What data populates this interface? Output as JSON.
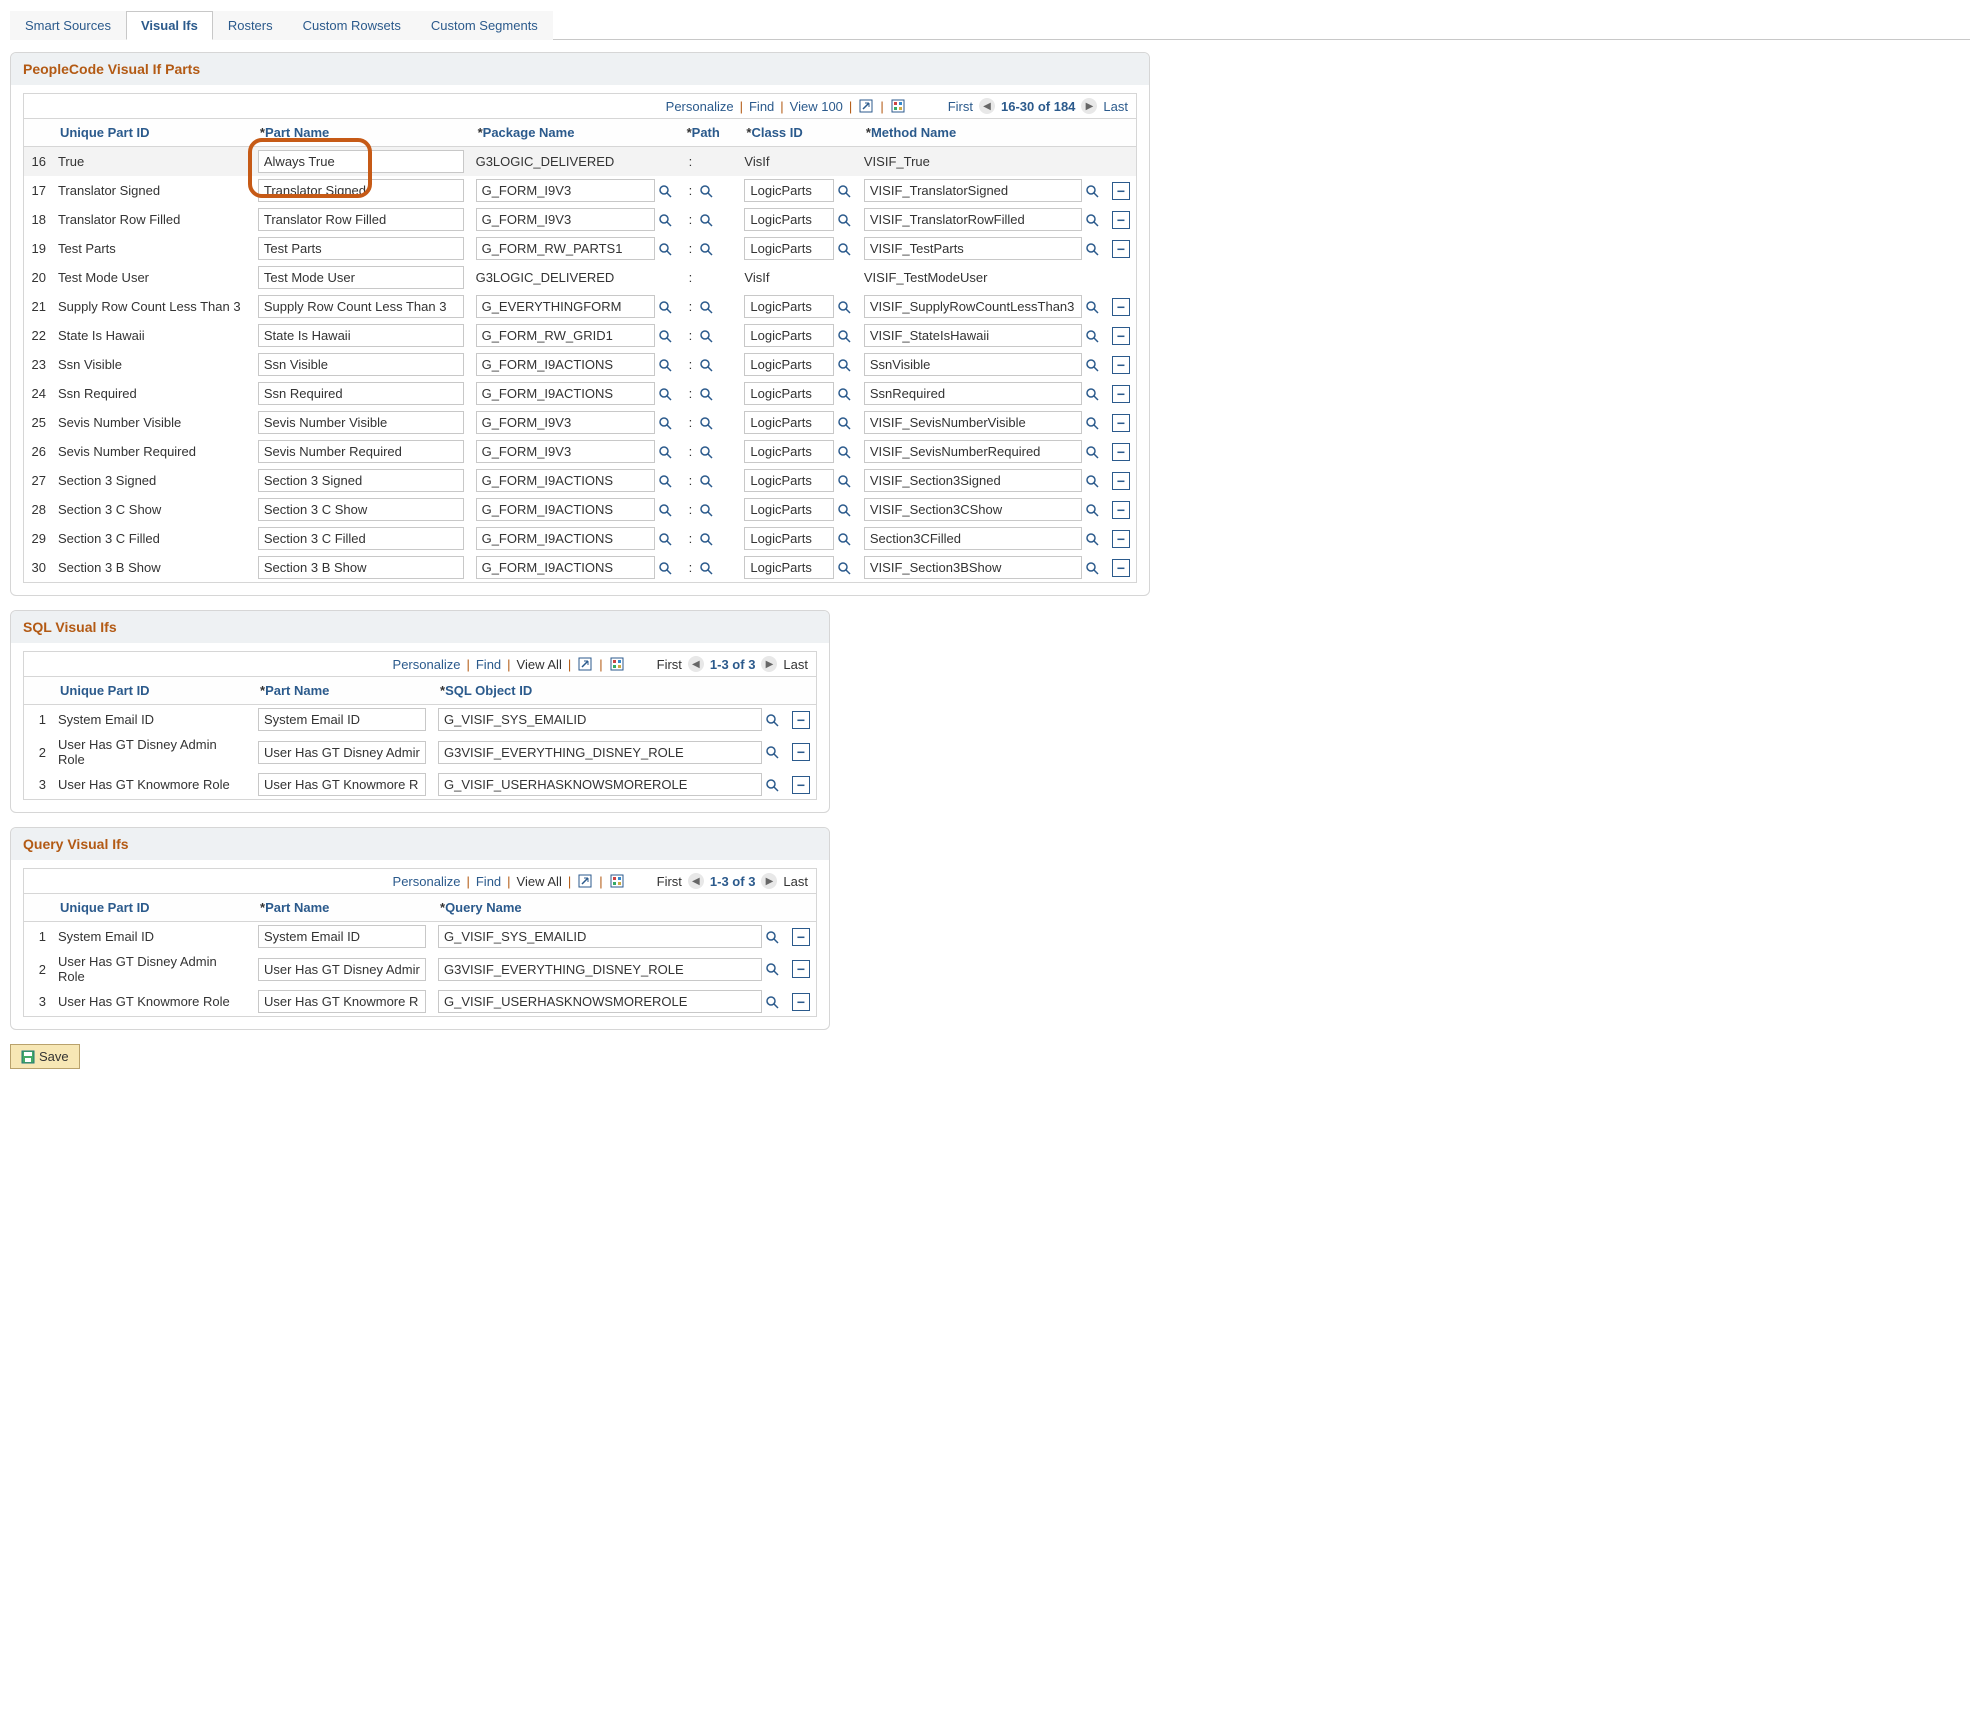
{
  "tabs": [
    "Smart Sources",
    "Visual Ifs",
    "Rosters",
    "Custom Rowsets",
    "Custom Segments"
  ],
  "active_tab": "Visual Ifs",
  "save_label": "Save",
  "toolbar": {
    "personalize": "Personalize",
    "find": "Find",
    "view100": "View 100",
    "viewall": "View All",
    "first": "First",
    "last": "Last"
  },
  "panels": {
    "pc": {
      "title": "PeopleCode Visual If Parts",
      "range": "16-30 of 184",
      "headers": {
        "id": "Unique Part ID",
        "name": "Part Name",
        "pkg": "Package Name",
        "path": "Path",
        "cls": "Class ID",
        "mth": "Method Name"
      },
      "rows": [
        {
          "n": 16,
          "id": "True",
          "name": "Always True",
          "pkg": "G3LOGIC_DELIVERED",
          "pkg_lookup": false,
          "path": "",
          "cls": "VisIf",
          "cls_lookup": false,
          "mth": "VISIF_True",
          "mth_lookup": false,
          "del": false,
          "alt": true
        },
        {
          "n": 17,
          "id": "Translator Signed",
          "name": "Translator Signed",
          "pkg": "G_FORM_I9V3",
          "pkg_lookup": true,
          "path": "",
          "cls": "LogicParts",
          "cls_lookup": true,
          "mth": "VISIF_TranslatorSigned",
          "mth_lookup": true,
          "del": true,
          "alt": false
        },
        {
          "n": 18,
          "id": "Translator Row Filled",
          "name": "Translator Row Filled",
          "pkg": "G_FORM_I9V3",
          "pkg_lookup": true,
          "path": "",
          "cls": "LogicParts",
          "cls_lookup": true,
          "mth": "VISIF_TranslatorRowFilled",
          "mth_lookup": true,
          "del": true,
          "alt": false
        },
        {
          "n": 19,
          "id": "Test Parts",
          "name": "Test Parts",
          "pkg": "G_FORM_RW_PARTS1",
          "pkg_lookup": true,
          "path": "",
          "cls": "LogicParts",
          "cls_lookup": true,
          "mth": "VISIF_TestParts",
          "mth_lookup": true,
          "del": true,
          "alt": false
        },
        {
          "n": 20,
          "id": "Test Mode User",
          "name": "Test Mode User",
          "pkg": "G3LOGIC_DELIVERED",
          "pkg_lookup": false,
          "path": "",
          "cls": "VisIf",
          "cls_lookup": false,
          "mth": "VISIF_TestModeUser",
          "mth_lookup": false,
          "del": false,
          "alt": false
        },
        {
          "n": 21,
          "id": "Supply Row Count Less Than 3",
          "name": "Supply Row Count Less Than 3",
          "pkg": "G_EVERYTHINGFORM",
          "pkg_lookup": true,
          "path": "",
          "cls": "LogicParts",
          "cls_lookup": true,
          "mth": "VISIF_SupplyRowCountLessThan3",
          "mth_lookup": true,
          "del": true,
          "alt": false
        },
        {
          "n": 22,
          "id": "State Is Hawaii",
          "name": "State Is Hawaii",
          "pkg": "G_FORM_RW_GRID1",
          "pkg_lookup": true,
          "path": "",
          "cls": "LogicParts",
          "cls_lookup": true,
          "mth": "VISIF_StateIsHawaii",
          "mth_lookup": true,
          "del": true,
          "alt": false
        },
        {
          "n": 23,
          "id": "Ssn Visible",
          "name": "Ssn Visible",
          "pkg": "G_FORM_I9ACTIONS",
          "pkg_lookup": true,
          "path": "",
          "cls": "LogicParts",
          "cls_lookup": true,
          "mth": "SsnVisible",
          "mth_lookup": true,
          "del": true,
          "alt": false
        },
        {
          "n": 24,
          "id": "Ssn Required",
          "name": "Ssn Required",
          "pkg": "G_FORM_I9ACTIONS",
          "pkg_lookup": true,
          "path": "",
          "cls": "LogicParts",
          "cls_lookup": true,
          "mth": "SsnRequired",
          "mth_lookup": true,
          "del": true,
          "alt": false
        },
        {
          "n": 25,
          "id": "Sevis Number Visible",
          "name": "Sevis Number Visible",
          "pkg": "G_FORM_I9V3",
          "pkg_lookup": true,
          "path": "",
          "cls": "LogicParts",
          "cls_lookup": true,
          "mth": "VISIF_SevisNumberVisible",
          "mth_lookup": true,
          "del": true,
          "alt": false
        },
        {
          "n": 26,
          "id": "Sevis Number Required",
          "name": "Sevis Number Required",
          "pkg": "G_FORM_I9V3",
          "pkg_lookup": true,
          "path": "",
          "cls": "LogicParts",
          "cls_lookup": true,
          "mth": "VISIF_SevisNumberRequired",
          "mth_lookup": true,
          "del": true,
          "alt": false
        },
        {
          "n": 27,
          "id": "Section 3 Signed",
          "name": "Section 3 Signed",
          "pkg": "G_FORM_I9ACTIONS",
          "pkg_lookup": true,
          "path": "",
          "cls": "LogicParts",
          "cls_lookup": true,
          "mth": "VISIF_Section3Signed",
          "mth_lookup": true,
          "del": true,
          "alt": false
        },
        {
          "n": 28,
          "id": "Section 3 C Show",
          "name": "Section 3 C Show",
          "pkg": "G_FORM_I9ACTIONS",
          "pkg_lookup": true,
          "path": "",
          "cls": "LogicParts",
          "cls_lookup": true,
          "mth": "VISIF_Section3CShow",
          "mth_lookup": true,
          "del": true,
          "alt": false
        },
        {
          "n": 29,
          "id": "Section 3 C Filled",
          "name": "Section 3 C Filled",
          "pkg": "G_FORM_I9ACTIONS",
          "pkg_lookup": true,
          "path": "",
          "cls": "LogicParts",
          "cls_lookup": true,
          "mth": "Section3CFilled",
          "mth_lookup": true,
          "del": true,
          "alt": false
        },
        {
          "n": 30,
          "id": "Section 3 B Show",
          "name": "Section 3 B Show",
          "pkg": "G_FORM_I9ACTIONS",
          "pkg_lookup": true,
          "path": "",
          "cls": "LogicParts",
          "cls_lookup": true,
          "mth": "VISIF_Section3BShow",
          "mth_lookup": true,
          "del": true,
          "alt": false
        }
      ]
    },
    "sql": {
      "title": "SQL Visual Ifs",
      "range": "1-3 of 3",
      "headers": {
        "id": "Unique Part ID",
        "name": "Part Name",
        "obj": "SQL Object ID"
      },
      "rows": [
        {
          "n": 1,
          "id": "System Email ID",
          "name": "System Email ID",
          "obj": "G_VISIF_SYS_EMAILID"
        },
        {
          "n": 2,
          "id": "User Has GT Disney Admin Role",
          "name": "User Has GT Disney Admir",
          "obj": "G3VISIF_EVERYTHING_DISNEY_ROLE"
        },
        {
          "n": 3,
          "id": "User Has GT Knowmore Role",
          "name": "User Has GT Knowmore R",
          "obj": "G_VISIF_USERHASKNOWSMOREROLE"
        }
      ]
    },
    "qry": {
      "title": "Query Visual Ifs",
      "range": "1-3 of 3",
      "headers": {
        "id": "Unique Part ID",
        "name": "Part Name",
        "obj": "Query Name"
      },
      "rows": [
        {
          "n": 1,
          "id": "System Email ID",
          "name": "System Email ID",
          "obj": "G_VISIF_SYS_EMAILID"
        },
        {
          "n": 2,
          "id": "User Has GT Disney Admin Role",
          "name": "User Has GT Disney Admir",
          "obj": "G3VISIF_EVERYTHING_DISNEY_ROLE"
        },
        {
          "n": 3,
          "id": "User Has GT Knowmore Role",
          "name": "User Has GT Knowmore R",
          "obj": "G_VISIF_USERHASKNOWSMOREROLE"
        }
      ]
    }
  }
}
